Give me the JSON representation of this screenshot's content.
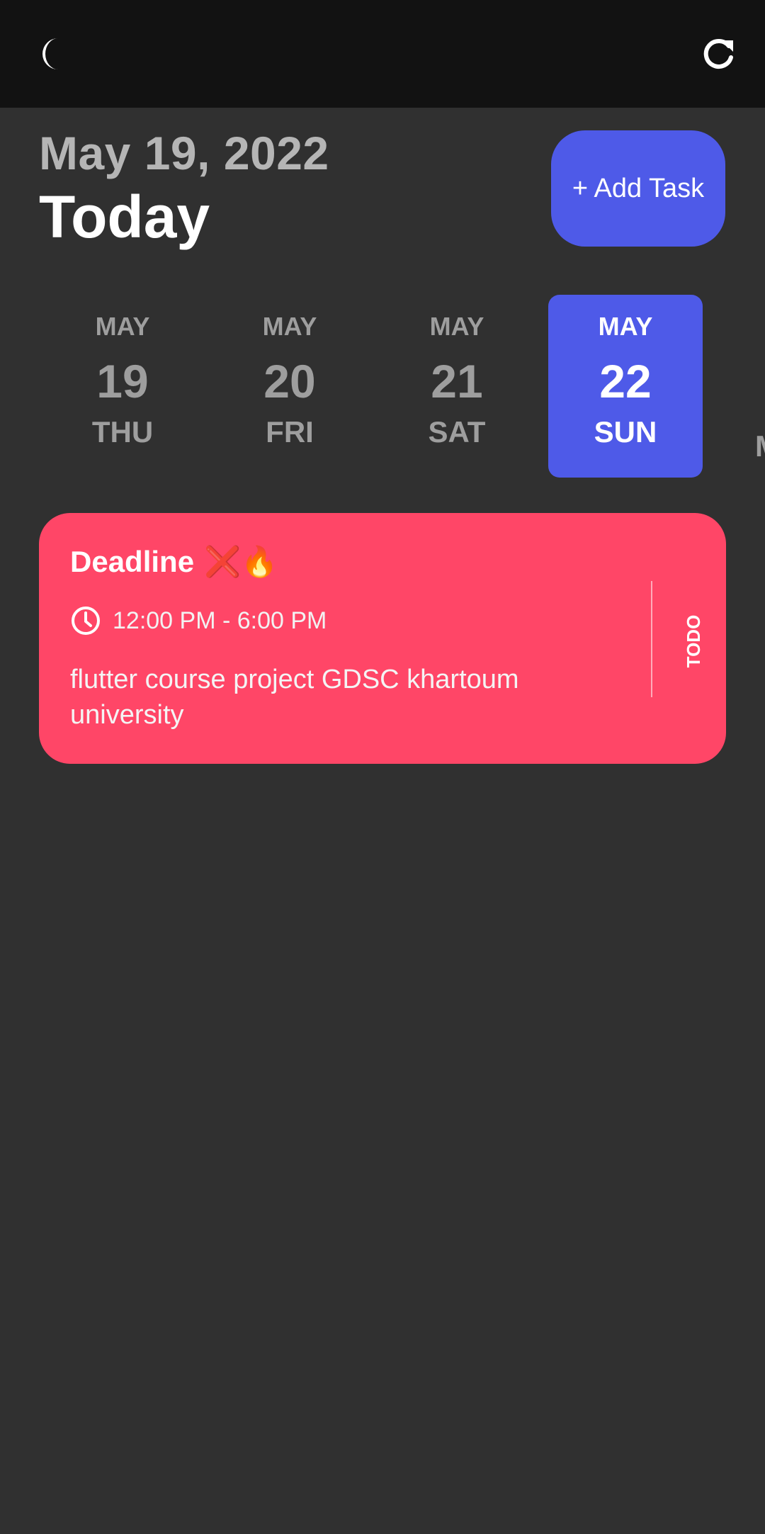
{
  "appbar": {
    "left_icon": "moon-icon",
    "right_icon": "refresh-icon"
  },
  "header": {
    "date": "May 19, 2022",
    "title": "Today",
    "add_task_label": "+ Add Task"
  },
  "date_strip": {
    "items": [
      {
        "month": "MAY",
        "day": "19",
        "weekday": "THU",
        "selected": false
      },
      {
        "month": "MAY",
        "day": "20",
        "weekday": "FRI",
        "selected": false
      },
      {
        "month": "MAY",
        "day": "21",
        "weekday": "SAT",
        "selected": false
      },
      {
        "month": "MAY",
        "day": "22",
        "weekday": "SUN",
        "selected": true
      },
      {
        "month": "",
        "day": "",
        "weekday": "M",
        "selected": false
      }
    ]
  },
  "tasks": [
    {
      "title": "Deadline",
      "title_emoji": "❌🔥",
      "time": "12:00 PM - 6:00 PM",
      "note": "flutter course project GDSC khartoum university",
      "status": "TODO",
      "color": "#FF4667"
    }
  ],
  "colors": {
    "background": "#303030",
    "appbar": "#121212",
    "accent": "#4E5AE8",
    "task_red": "#FF4667"
  }
}
